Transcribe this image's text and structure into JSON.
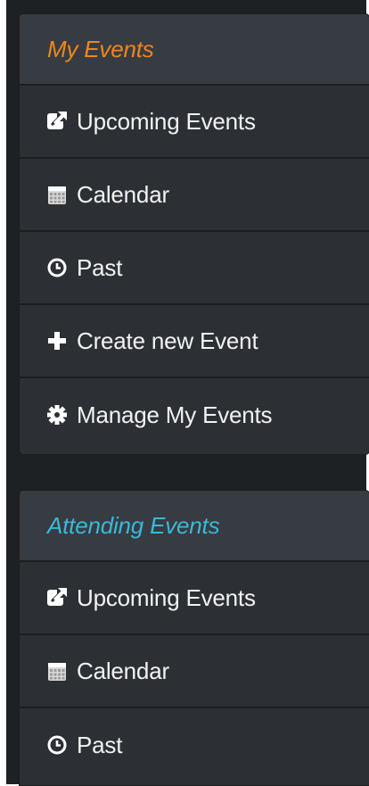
{
  "colors": {
    "my_events_title": "#f0861a",
    "attending_events_title": "#3bb8d9"
  },
  "my_events": {
    "title": "My Events",
    "items": [
      {
        "label": "Upcoming Events",
        "icon": "external-link-icon"
      },
      {
        "label": "Calendar",
        "icon": "calendar-icon"
      },
      {
        "label": "Past",
        "icon": "clock-icon"
      },
      {
        "label": "Create new Event",
        "icon": "plus-icon"
      },
      {
        "label": "Manage My Events",
        "icon": "gear-icon"
      }
    ]
  },
  "attending_events": {
    "title": "Attending Events",
    "items": [
      {
        "label": "Upcoming Events",
        "icon": "external-link-icon"
      },
      {
        "label": "Calendar",
        "icon": "calendar-icon"
      },
      {
        "label": "Past",
        "icon": "clock-icon"
      }
    ]
  }
}
